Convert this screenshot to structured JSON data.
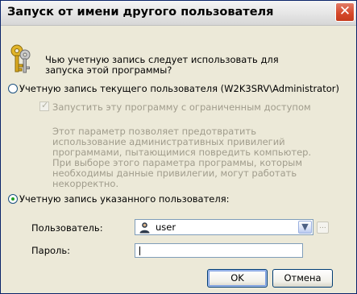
{
  "window": {
    "title": "Запуск от имени другого пользователя",
    "close_glyph": "✕"
  },
  "prompt": "Чью учетную запись следует использовать для запуска этой программы?",
  "current_account": {
    "label": "Учетную запись текущего пользователя (W2K3SRV\\Administrator)",
    "selected": false,
    "restricted_checkbox": {
      "label": "Запустить эту программу с ограниченным доступом",
      "checked": true,
      "enabled": false
    },
    "description": "Этот параметр позволяет предотвратить использование административных привилегий программами, пытающимися повредить компьютер.  При выборе этого параметра программы, которым необходимы данные привилегии, могут работать некорректно."
  },
  "specified_account": {
    "label": "Учетную запись указанного пользователя:",
    "selected": true
  },
  "user_field": {
    "label": "Пользователь:",
    "value": "user",
    "browse_label": "..."
  },
  "password_field": {
    "label": "Пароль:",
    "value": ""
  },
  "buttons": {
    "ok": "OK",
    "cancel": "Отмена"
  },
  "icons": [
    "keys-icon",
    "user-icon",
    "chevron-down-icon",
    "close-icon"
  ],
  "colors": {
    "dialog_background": "#ece9d8",
    "radio_dot": "#21a121",
    "close_button": "#d6492c",
    "disabled_text": "#a09c8c"
  }
}
